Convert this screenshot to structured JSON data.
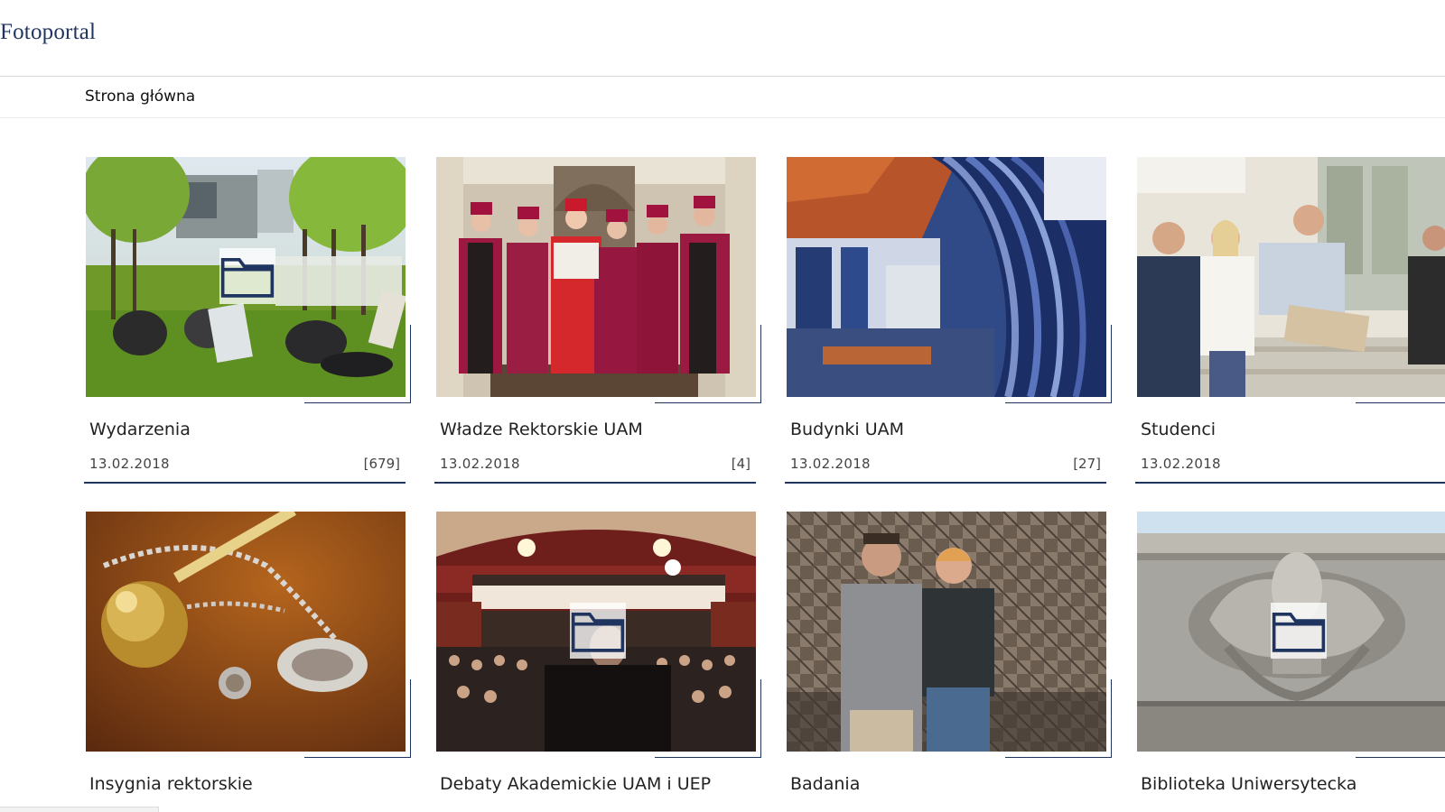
{
  "header": {
    "brand": "Fotoportal"
  },
  "breadcrumb": {
    "home_label": "Strona główna"
  },
  "galleries": [
    {
      "title": "Wydarzenia",
      "date": "13.02.2018",
      "count": "[679]",
      "folder_icon": "folder-icon"
    },
    {
      "title": "Władze Rektorskie UAM",
      "date": "13.02.2018",
      "count": "[4]",
      "folder_icon": "folder-icon"
    },
    {
      "title": "Budynki UAM",
      "date": "13.02.2018",
      "count": "[27]",
      "folder_icon": "folder-icon"
    },
    {
      "title": "Studenci",
      "date": "13.02.2018",
      "count": "[",
      "folder_icon": "folder-icon"
    },
    {
      "title": "Insygnia rektorskie",
      "folder_icon": "folder-icon"
    },
    {
      "title": "Debaty Akademickie UAM i UEP",
      "folder_icon": "folder-icon"
    },
    {
      "title": "Badania",
      "folder_icon": "folder-icon"
    },
    {
      "title": "Biblioteka Uniwersytecka",
      "folder_icon": "folder-icon"
    }
  ],
  "colors": {
    "accent": "#1f3560",
    "text": "#222222",
    "divider": "#d9d9d9"
  }
}
